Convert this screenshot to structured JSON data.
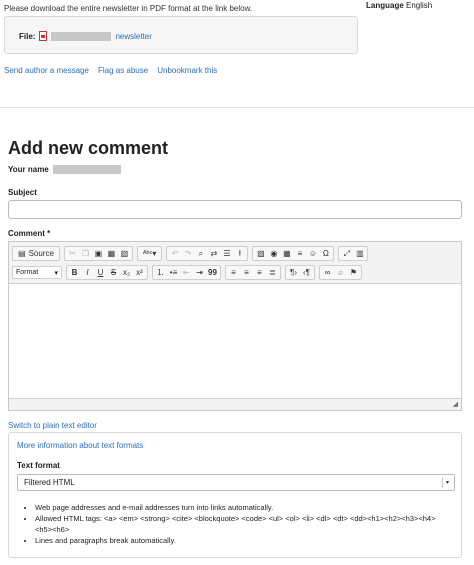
{
  "intro_text": "Please download the entire newsletter in PDF format at the link below.",
  "language": {
    "label": "Language",
    "value": "English"
  },
  "file": {
    "label": "File:",
    "link_text": "newsletter"
  },
  "actions": [
    "Send author a message",
    "Flag as abuse",
    "Unbookmark this"
  ],
  "comment_form": {
    "title": "Add new comment",
    "your_name_label": "Your name",
    "subject_label": "Subject",
    "comment_label": "Comment *",
    "switch_editor": "Switch to plain text editor"
  },
  "toolbar": {
    "source_label": "Source",
    "format_label": "Format",
    "bold": "B",
    "italic": "I",
    "underline": "U",
    "strike": "S",
    "subscript": "x₂",
    "superscript": "x²",
    "blockquote": "99"
  },
  "formats": {
    "more_info": "More information about text formats",
    "text_format_label": "Text format",
    "selected": "Filtered HTML",
    "tips": [
      "Web page addresses and e-mail addresses turn into links automatically.",
      "Allowed HTML tags: <a> <em> <strong> <cite> <blockquote> <code> <ul> <ol> <li> <dl> <dt> <dd><h1><h2><h3><h4><h5><h6>",
      "Lines and paragraphs break automatically."
    ]
  },
  "icons": [
    "pdf-icon",
    "source-icon",
    "cut-icon",
    "copy-icon",
    "paste-icon",
    "paste-text-icon",
    "paste-word-icon",
    "spellcheck-icon",
    "undo-icon",
    "redo-icon",
    "find-icon",
    "replace-icon",
    "select-all-icon",
    "remove-format-icon",
    "image-icon",
    "flash-icon",
    "table-icon",
    "horizontal-rule-icon",
    "smiley-icon",
    "special-char-icon",
    "maximize-icon",
    "show-blocks-icon",
    "numbered-list-icon",
    "bulleted-list-icon",
    "outdent-icon",
    "indent-icon",
    "align-left-icon",
    "align-center-icon",
    "align-right-icon",
    "justify-icon",
    "ltr-icon",
    "rtl-icon",
    "link-icon",
    "unlink-icon",
    "anchor-icon",
    "resize-icon"
  ]
}
